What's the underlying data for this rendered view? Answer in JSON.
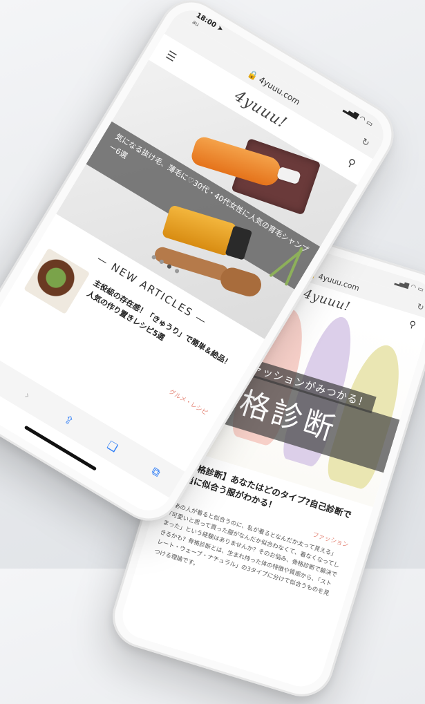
{
  "front_phone": {
    "status": {
      "time": "18:00",
      "carrier": "au"
    },
    "url": "4yuuu.com",
    "logo": "4yuuu!",
    "hero_caption": "気になる抜け毛、薄毛に♡30代・40代女性に人気の育毛シャンプー6選",
    "section_heading": "NEW ARTICLES",
    "article": {
      "title": "主役級の存在感！「きゅうり」で簡単＆絶品！人気の作り置きレシピ5選",
      "category": "グルメ・レシピ"
    },
    "icons": [
      "back-chevron-icon",
      "forward-chevron-icon",
      "share-icon",
      "bookmarks-icon",
      "tabs-icon"
    ]
  },
  "back_phone": {
    "url": "4yuuu.com",
    "logo": "4yuuu!",
    "hero_subtitle": "ラフファッションがみつかる！",
    "hero_title": "骨格診断",
    "article": {
      "title": "【骨格診断】あなたはどのタイプ?自己診断で本当に似合う服がわかる！",
      "category": "ファッション",
      "body": "「あの人が着ると似合うのに、私が着るとなんだか太って見える」「可愛いと思って買った服がなんだか似合わなくて、着なくなってしまった」という経験はありませんか？そのお悩み、骨格診断で解決できるかも？骨格診断とは、生まれ持った体の特徴や質感から、「ストレート・ウェーブ・ナチュラル」の3タイプに分けて似合うものを見つける理論です。"
    }
  }
}
